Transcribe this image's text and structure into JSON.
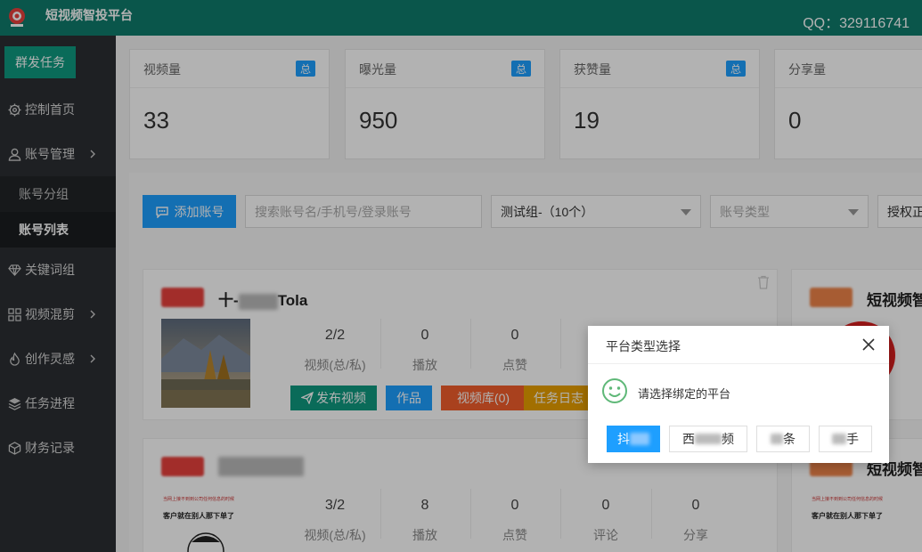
{
  "header": {
    "app_title": "短视频智投平台",
    "qq_text": "QQ：329116741"
  },
  "sidebar": {
    "mass_task_button": "群发任务",
    "items": [
      {
        "label": "控制首页",
        "icon": "gear-icon"
      },
      {
        "label": "账号管理",
        "icon": "user-icon",
        "expandable": true
      },
      {
        "label": "关键词组",
        "icon": "diamond-icon"
      },
      {
        "label": "视频混剪",
        "icon": "grid-icon",
        "expandable": true
      },
      {
        "label": "创作灵感",
        "icon": "flame-icon",
        "expandable": true
      },
      {
        "label": "任务进程",
        "icon": "layers-icon"
      },
      {
        "label": "财务记录",
        "icon": "cube-icon"
      }
    ],
    "sub_items": [
      {
        "label": "账号分组",
        "active": false
      },
      {
        "label": "账号列表",
        "active": true
      }
    ]
  },
  "stats": [
    {
      "label": "视频量",
      "badge": "总",
      "value": "33"
    },
    {
      "label": "曝光量",
      "badge": "总",
      "value": "950"
    },
    {
      "label": "获赞量",
      "badge": "总",
      "value": "19"
    },
    {
      "label": "分享量",
      "badge": "",
      "value": "0"
    }
  ],
  "toolbar": {
    "add_account": "添加账号",
    "search_placeholder": "搜索账号名/手机号/登录账号",
    "group_select": "测试组-（10个）",
    "type_select": "账号类型",
    "auth_select": "授权正"
  },
  "cards": [
    {
      "name_prefix": "十-",
      "name_suffix": "Tola",
      "metrics": [
        {
          "value": "2/2",
          "label": "视频(总/私)"
        },
        {
          "value": "0",
          "label": "播放"
        },
        {
          "value": "0",
          "label": "点赞"
        }
      ],
      "actions": [
        "发布视频",
        "作品",
        "视频库(0)",
        "任务日志"
      ]
    },
    {
      "name_prefix": "",
      "name_suffix": "",
      "metrics": [
        {
          "value": "3/2",
          "label": "视频(总/私)"
        },
        {
          "value": "8",
          "label": "播放"
        },
        {
          "value": "0",
          "label": "点赞"
        },
        {
          "value": "0",
          "label": "评论"
        },
        {
          "value": "0",
          "label": "分享"
        }
      ],
      "thumb_text_1": "当网上接不到到公司任何信息的时候",
      "thumb_text_2": "客户就在别人那下单了"
    }
  ],
  "right_cards": [
    {
      "name": "短视频智"
    },
    {
      "name": "短视频智"
    }
  ],
  "modal": {
    "title": "平台类型选择",
    "message": "请选择绑定的平台",
    "buttons": [
      {
        "label": "抖",
        "primary": true
      },
      {
        "label_left": "西",
        "label_right": "频",
        "primary": false
      },
      {
        "label_right": "条",
        "primary": false
      },
      {
        "label_right": "手",
        "primary": false
      }
    ]
  },
  "colors": {
    "header_bg": "#0f7b6c",
    "sidebar_bg": "#2b2f33",
    "primary_blue": "#1e9fff",
    "green": "#0f9a80",
    "red": "#e8413d",
    "orange": "#e8a000"
  }
}
